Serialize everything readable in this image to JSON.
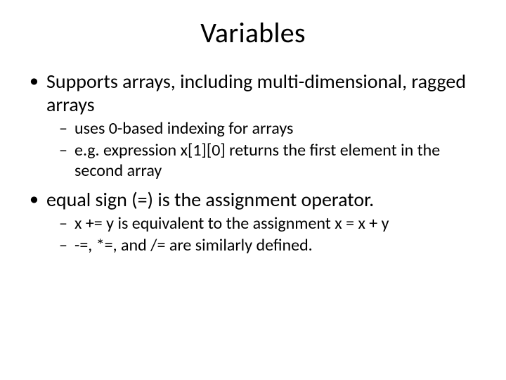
{
  "title": "Variables",
  "bullets": [
    {
      "text": "Supports arrays, including multi-dimensional, ragged arrays",
      "sub": [
        "uses 0-based indexing for arrays",
        "e.g. expression x[1][0] returns the first element in the second array"
      ]
    },
    {
      "text": "equal sign (=) is the assignment operator.",
      "sub": [
        "x += y is equivalent to the assignment x = x + y",
        "-=, *=, and /= are similarly defined."
      ]
    }
  ]
}
